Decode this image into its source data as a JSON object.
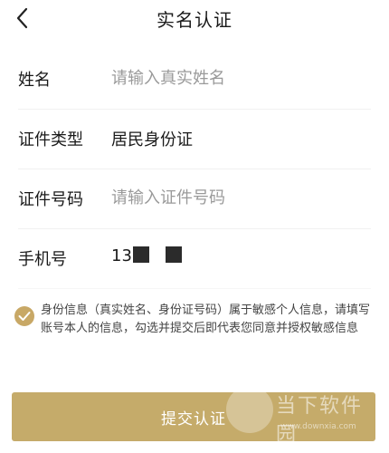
{
  "header": {
    "title": "实名认证"
  },
  "form": {
    "name": {
      "label": "姓名",
      "placeholder": "请输入真实姓名"
    },
    "id_type": {
      "label": "证件类型",
      "value": "居民身份证"
    },
    "id_number": {
      "label": "证件号码",
      "placeholder": "请输入证件号码"
    },
    "phone": {
      "label": "手机号",
      "value_prefix": "13"
    }
  },
  "consent": {
    "checked": true,
    "text": "身份信息（真实姓名、身份证号码）属于敏感个人信息，请填写账号本人的信息，勾选并提交后即代表您同意并授权敏感信息"
  },
  "submit": {
    "label": "提交认证"
  },
  "watermark": {
    "name": "当下软件园",
    "url": "www.downxia.com"
  },
  "colors": {
    "accent": "#c5ab6a",
    "placeholder": "#9a9a9a"
  }
}
